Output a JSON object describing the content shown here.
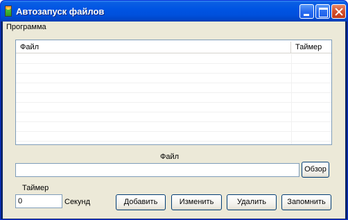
{
  "window": {
    "title": "Автозапуск файлов"
  },
  "menu": {
    "items": [
      {
        "label": "Программа"
      }
    ]
  },
  "list": {
    "columns": [
      {
        "label": "Файл"
      },
      {
        "label": "Таймер"
      }
    ],
    "rows": []
  },
  "form": {
    "file_label": "Файл",
    "file_value": "",
    "browse_label": "Обзор",
    "timer_label": "Таймер",
    "timer_value": "0",
    "seconds_label": "Секунд"
  },
  "buttons": {
    "add": "Добавить",
    "edit": "Изменить",
    "delete": "Удалить",
    "save": "Запомнить"
  },
  "colors": {
    "titlebar": "#0054e3",
    "client_bg": "#ece9d8",
    "border": "#7f9db9"
  }
}
